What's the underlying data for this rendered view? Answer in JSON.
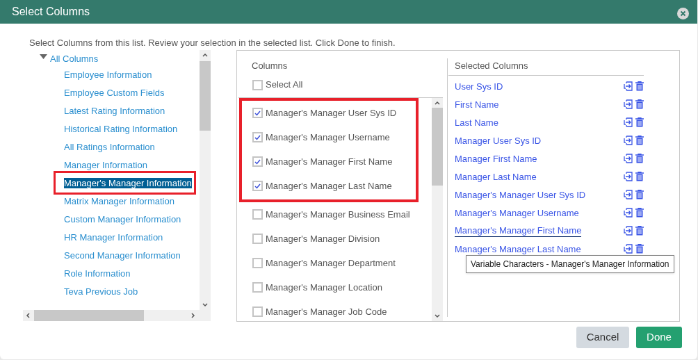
{
  "window": {
    "title": "Select Columns"
  },
  "instructions": "Select Columns from this list. Review your selection in the selected list. Click Done to finish.",
  "tree": {
    "label": "All Columns",
    "expanded": true,
    "children": [
      {
        "label": "Employee Information",
        "selected": false,
        "highlighted": false
      },
      {
        "label": "Employee Custom Fields",
        "selected": false,
        "highlighted": false
      },
      {
        "label": "Latest Rating Information",
        "selected": false,
        "highlighted": false
      },
      {
        "label": "Historical Rating Information",
        "selected": false,
        "highlighted": false
      },
      {
        "label": "All Ratings Information",
        "selected": false,
        "highlighted": false
      },
      {
        "label": "Manager Information",
        "selected": false,
        "highlighted": false
      },
      {
        "label": "Manager's Manager Information",
        "selected": true,
        "highlighted": true
      },
      {
        "label": "Matrix Manager Information",
        "selected": false,
        "highlighted": false
      },
      {
        "label": "Custom Manager Information",
        "selected": false,
        "highlighted": false
      },
      {
        "label": "HR Manager Information",
        "selected": false,
        "highlighted": false
      },
      {
        "label": "Second Manager Information",
        "selected": false,
        "highlighted": false
      },
      {
        "label": "Role Information",
        "selected": false,
        "highlighted": false
      },
      {
        "label": "Teva Previous Job",
        "selected": false,
        "highlighted": false
      }
    ]
  },
  "columns": {
    "heading": "Columns",
    "select_all": {
      "label": "Select All",
      "checked": false
    },
    "items": [
      {
        "label": "Manager's Manager User Sys ID",
        "checked": true,
        "highlighted": true
      },
      {
        "label": "Manager's Manager Username",
        "checked": true,
        "highlighted": true
      },
      {
        "label": "Manager's Manager First Name",
        "checked": true,
        "highlighted": true
      },
      {
        "label": "Manager's Manager Last Name",
        "checked": true,
        "highlighted": true
      },
      {
        "label": "Manager's Manager Business Email",
        "checked": false,
        "highlighted": false
      },
      {
        "label": "Manager's Manager Division",
        "checked": false,
        "highlighted": false
      },
      {
        "label": "Manager's Manager Department",
        "checked": false,
        "highlighted": false
      },
      {
        "label": "Manager's Manager Location",
        "checked": false,
        "highlighted": false
      },
      {
        "label": "Manager's Manager Job Code",
        "checked": false,
        "highlighted": false
      }
    ]
  },
  "selected_columns": {
    "heading": "Selected Columns",
    "items": [
      {
        "label": "User Sys ID",
        "focused": false
      },
      {
        "label": "First Name",
        "focused": false
      },
      {
        "label": "Last Name",
        "focused": false
      },
      {
        "label": "Manager User Sys ID",
        "focused": false
      },
      {
        "label": "Manager First Name",
        "focused": false
      },
      {
        "label": "Manager Last Name",
        "focused": false
      },
      {
        "label": "Manager's Manager User Sys ID",
        "focused": false
      },
      {
        "label": "Manager's Manager Username",
        "focused": false
      },
      {
        "label": "Manager's Manager First Name",
        "focused": true
      },
      {
        "label": "Manager's Manager Last Name",
        "focused": false
      }
    ]
  },
  "tooltip": "Variable Characters - Manager's Manager Information",
  "buttons": [
    {
      "label": "Cancel",
      "kind": "secondary"
    },
    {
      "label": "Done",
      "kind": "primary"
    }
  ]
}
